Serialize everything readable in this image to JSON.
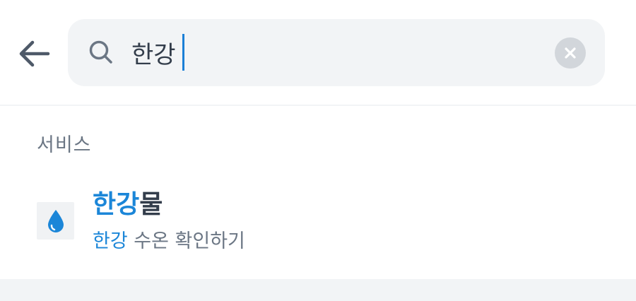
{
  "search": {
    "value": "한강",
    "placeholder": ""
  },
  "icons": {
    "back": "arrow-left-icon",
    "search": "search-icon",
    "clear": "clear-circle-x-icon",
    "result": "water-drop-icon"
  },
  "section": {
    "title": "서비스"
  },
  "results": [
    {
      "title_highlight": "한강",
      "title_rest": "물",
      "subtitle_highlight": "한강",
      "subtitle_rest": " 수온 확인하기"
    }
  ],
  "colors": {
    "highlight": "#1b86d8",
    "text_primary": "#333d4b",
    "text_secondary": "#6b7684",
    "search_bg": "#f2f4f6"
  }
}
